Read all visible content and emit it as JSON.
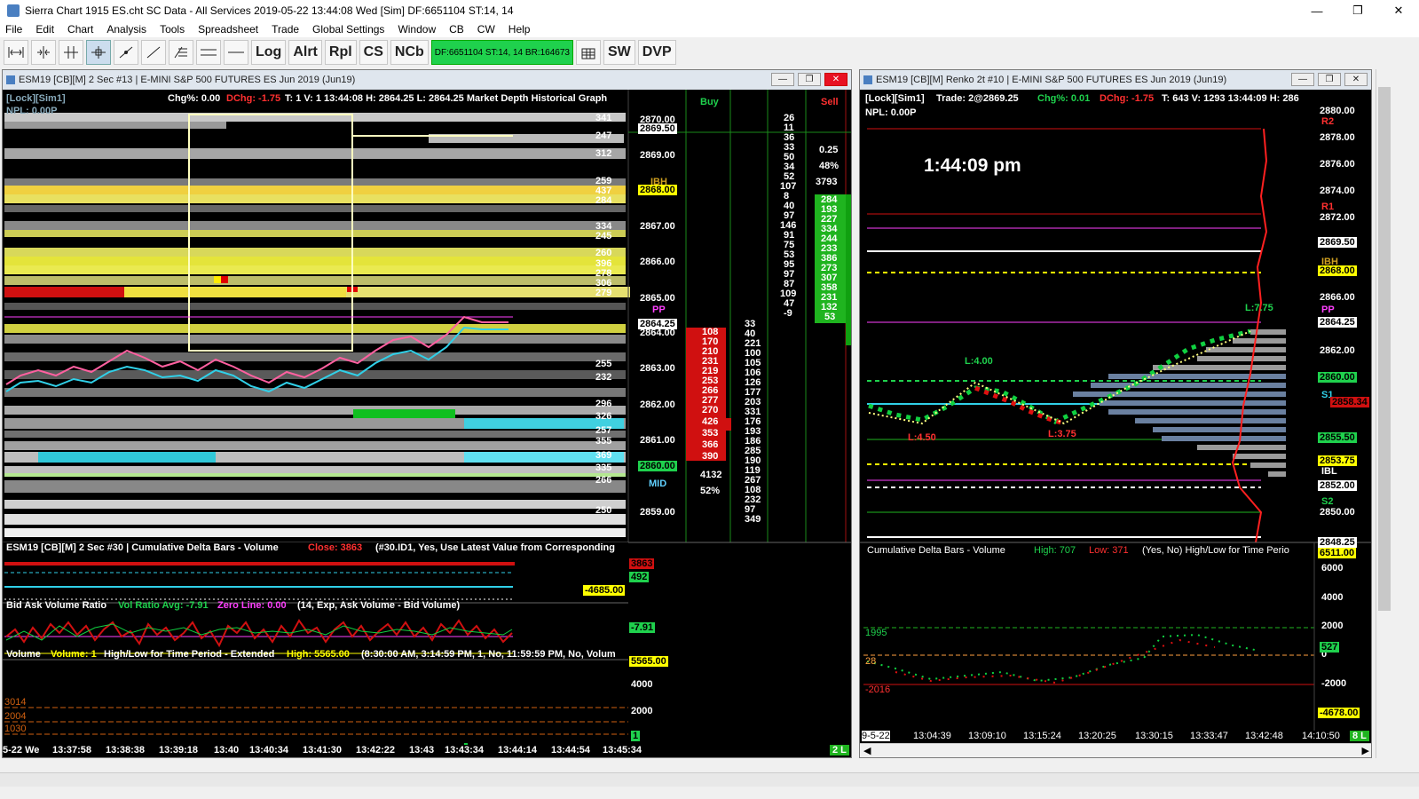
{
  "window": {
    "title": "Sierra Chart 1915 ES.cht  SC Data - All Services 2019-05-22  13:44:08 Wed [Sim]  DF:6651104  ST:14, 14",
    "min": "—",
    "max": "❐",
    "close": "✕"
  },
  "menu": [
    "File",
    "Edit",
    "Chart",
    "Analysis",
    "Tools",
    "Spreadsheet",
    "Trade",
    "Global Settings",
    "Window",
    "CB",
    "CW",
    "Help"
  ],
  "toolbar": {
    "log": "Log",
    "alrt": "Alrt",
    "rpl": "Rpl",
    "cs": "CS",
    "ncb": "NCb",
    "df": "DF:6651104  ST:14, 14  BR:164673",
    "sw": "SW",
    "dvp": "DVP"
  },
  "left_chart": {
    "header": "ESM19 [CB][M]  2 Sec  #13 | E-MINI S&P 500 FUTURES ES Jun 2019 (Jun19)",
    "status_lock": "[Lock][Sim1]",
    "status_npl": "NPL: 0.00P",
    "chg": "Chg%: 0.00",
    "dchg": "DChg: -1.75",
    "status_rest": "T: 1 V: 1 13:44:08 H: 2864.25 L: 2864.25 Market Depth Historical Graph",
    "buy_label": "Buy",
    "sell_label": "Sell",
    "price_labels": [
      "2870.00",
      "2869.00",
      "2868.00",
      "2867.00",
      "2866.00",
      "2865.00",
      "2864.00",
      "2863.00",
      "2862.00",
      "2861.00",
      "2860.00",
      "2859.00"
    ],
    "tag_2869_50": "2869.50",
    "tag_ibh": "IBH",
    "tag_2868": "2868.00",
    "tag_pp": "PP",
    "tag_last": "2864.25",
    "tag_2860": "2860.00",
    "tag_mid": "MID",
    "tag_s1": "S1",
    "bid_sizes": [
      "341",
      "247",
      "312",
      "259",
      "437",
      "284",
      "334",
      "245",
      "260",
      "396",
      "278",
      "306",
      "279"
    ],
    "ask_sizes": [
      "255",
      "232",
      "296",
      "290",
      "326",
      "257",
      "355",
      "369",
      "335",
      "312",
      "266",
      "250",
      "299",
      "312"
    ],
    "buy_col": [
      "108",
      "170",
      "210",
      "231",
      "219",
      "253",
      "266",
      "277",
      "297",
      "270",
      "426",
      "296",
      "353",
      "366",
      "390"
    ],
    "sell_col_left": [
      "33",
      "40",
      "221",
      "100",
      "105",
      "106",
      "126",
      "177",
      "203",
      "331",
      "176",
      "193",
      "186",
      "285",
      "190",
      "119",
      "267",
      "108",
      "232",
      "97",
      "52",
      "349",
      "131"
    ],
    "sell_col_top": [
      "26",
      "11",
      "36",
      "33",
      "33",
      "50",
      "34",
      "52",
      "107",
      "8",
      "40",
      "97",
      "146",
      "91",
      "75",
      "53",
      "95",
      "97",
      "95",
      "87",
      "109",
      "47",
      "-9"
    ],
    "sell_vals_right": [
      "284",
      "193",
      "227",
      "334",
      "244",
      "233",
      "259",
      "386",
      "273",
      "307",
      "279",
      "358",
      "231",
      "132",
      "53"
    ],
    "pct1": "0.25",
    "pct2": "48%",
    "sum_sell": "3793",
    "sum_buy": "4132",
    "pct_buy": "52%",
    "cd_header": "ESM19 [CB][M]  2 Sec  #30 | Cumulative Delta Bars - Volume",
    "cd_close": "Close: 3863",
    "cd_rest": "(#30.ID1, Yes, Use Latest Value from Corresponding",
    "cd_tag1": "3863",
    "cd_tag2": "492",
    "cd_tag3": "-4685.00",
    "cd_tag4": "0604.00",
    "bav_header": "Bid Ask Volume Ratio",
    "bav_avg": "Vol Ratio Avg: -7.91",
    "bav_zero": "Zero Line: 0.00",
    "bav_rest": "(14, Exp, Ask Volume - Bid Volume)",
    "bav_tag": "-7.91",
    "vol_header": "Volume",
    "vol_val": "Volume: 1",
    "vol_hl": "High/Low for Time Period - Extended",
    "vol_high": "High: 5565.00",
    "vol_rest": "(8:30:00 AM, 3:14:59 PM, 1, No, 11:59:59 PM, No, Volum",
    "vol_tag": "5565.00",
    "vol_axis": [
      "4000",
      "2000"
    ],
    "vol_levels": [
      "3014",
      "2004",
      "1030"
    ],
    "vol_last": "1",
    "time_labels": [
      "5-22 We",
      "13:37:58",
      "13:38:38",
      "13:39:18",
      "13:40",
      "13:40:34",
      "13:41:30",
      "13:42:22",
      "13:43",
      "13:43:34",
      "13:44:14",
      "13:44:54",
      "13:45:34"
    ],
    "badge": "2 L",
    "s1_tag": "S1",
    "s1_val": "25",
    "s1_left": "28"
  },
  "right_chart": {
    "header": "ESM19 [CB][M]  Renko 2t  #10 | E-MINI S&P 500 FUTURES ES Jun 2019 (Jun19)",
    "status_lock": "[Lock][Sim1]",
    "status_trade": "Trade: 2@2869.25",
    "status_chg": "Chg%: 0.01",
    "status_dchg": "DChg: -1.75",
    "status_rest": "T: 643 V: 1293 13:44:09 H: 286",
    "npl": "NPL: 0.00P",
    "clock": "1:44:09 pm",
    "price_axis": [
      "2880.00",
      "2878.00",
      "2876.00",
      "2874.00",
      "2872.00",
      "2870.00",
      "2866.00",
      "2862.00",
      "2850.00"
    ],
    "tag_r2": "R2",
    "tag_r1": "R1",
    "tag_2869_50": "2869.50",
    "tag_ibh": "IBH",
    "tag_2868": "2868.00",
    "tag_pp": "PP",
    "tag_last": "2864.25",
    "tag_2860": "2860.00",
    "tag_s1": "S1",
    "tag_2858": "2858.34",
    "tag_2855": "2855.50",
    "tag_2853": "2853.75",
    "tag_ibl": "IBL",
    "tag_2852": "2852.00",
    "tag_s2": "S2",
    "tag_2848": "2848.25",
    "ann_l4": "L:4.00",
    "ann_l450": "L:4.50",
    "ann_l375": "L:3.75",
    "ann_l775": "L:7.75",
    "cd_header": "Cumulative Delta Bars - Volume",
    "cd_high": "High: 707",
    "cd_low": "Low: 371",
    "cd_rest": "(Yes, No)  High/Low for Time Perio",
    "cd_axis": [
      "6000",
      "4000",
      "2000",
      "0",
      "-2000"
    ],
    "cd_tag_top": "6511.00",
    "cd_1995": "1995",
    "cd_28": "28",
    "cd_m2016": "-2016",
    "cd_last": "527",
    "cd_bottom": "-4678.00",
    "time_labels": [
      "9-5-22",
      "13:04:39",
      "13:09:10",
      "13:15:24",
      "13:20:25",
      "13:30:15",
      "13:33:47",
      "13:42:48",
      "14:10:50"
    ],
    "badge": "8 L"
  }
}
